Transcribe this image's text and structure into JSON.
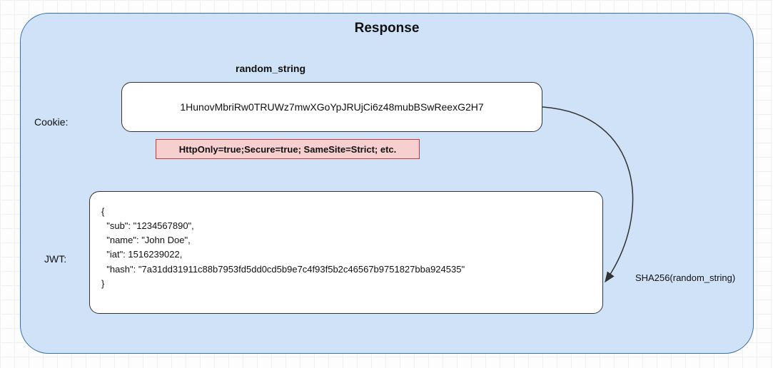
{
  "title": "Response",
  "labels": {
    "random_string": "random_string",
    "cookie": "Cookie:",
    "jwt": "JWT:",
    "sha": "SHA256(random_string)"
  },
  "cookie": {
    "value": "1HunovMbriRw0TRUWz7mwXGoYpJRUjCi6z48mubBSwReexG2H7",
    "attributes": "HttpOnly=true;Secure=true; SameSite=Strict; etc."
  },
  "jwt": {
    "sub": "1234567890",
    "name": "John Doe",
    "iat": 1516239022,
    "hash": "7a31dd31911c88b7953fd5dd0cd5b9e7c4f93f5b2c46567b9751827bba924535"
  }
}
